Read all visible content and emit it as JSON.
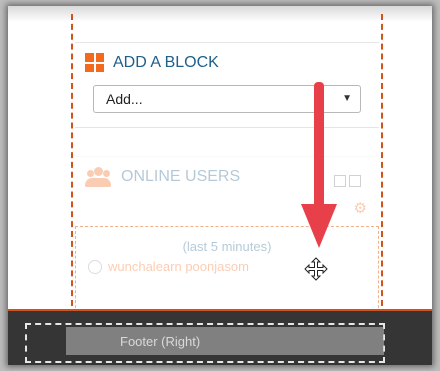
{
  "add_block": {
    "title": "ADD A BLOCK",
    "select": {
      "value": "Add...",
      "caret": "▼"
    }
  },
  "online_users": {
    "title": "ONLINE USERS",
    "subtitle": "(last 5 minutes)",
    "users": [
      {
        "name": "wunchalearn poonjasom"
      }
    ]
  },
  "footer": {
    "label": "Footer (Right)"
  },
  "colors": {
    "accent": "#f26b1d",
    "dash": "#d2541a",
    "arrow": "#e8404a",
    "footer_bg": "#353535",
    "title": "#1f5f8b"
  }
}
